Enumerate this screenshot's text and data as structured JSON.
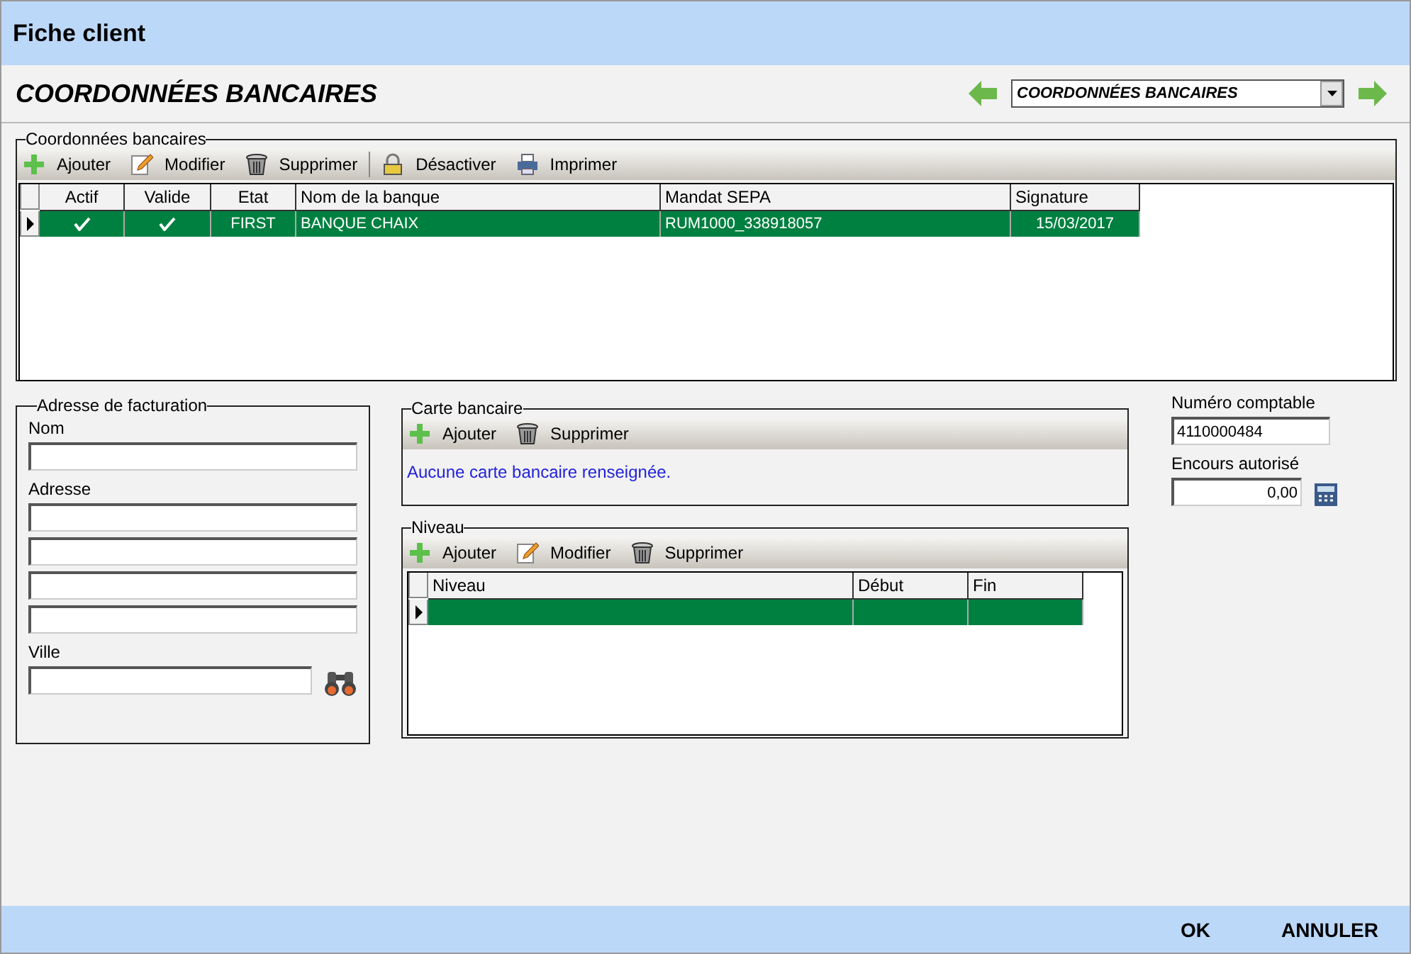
{
  "window": {
    "title": "Fiche client"
  },
  "header": {
    "title": "COORDONNÉES BANCAIRES",
    "select_value": "COORDONNÉES BANCAIRES"
  },
  "bank_details": {
    "title": "Coordonnées bancaires",
    "toolbar": [
      {
        "kind": "add",
        "label": "Ajouter"
      },
      {
        "kind": "edit",
        "label": "Modifier"
      },
      {
        "kind": "delete",
        "label": "Supprimer"
      },
      {
        "kind": "deactivate",
        "label": "Désactiver"
      },
      {
        "kind": "print",
        "label": "Imprimer"
      }
    ],
    "columns": [
      "Actif",
      "Valide",
      "Etat",
      "Nom de la banque",
      "Mandat SEPA",
      "Signature"
    ],
    "rows": [
      {
        "selected": true,
        "actif": true,
        "valide": true,
        "etat": "FIRST",
        "banque": "BANQUE CHAIX",
        "mandat": "RUM1000_338918057",
        "signature": "15/03/2017"
      }
    ]
  },
  "billing_address": {
    "title": "Adresse de facturation",
    "name_label": "Nom",
    "address_label": "Adresse",
    "city_label": "Ville"
  },
  "bank_card": {
    "title": "Carte bancaire",
    "toolbar": [
      {
        "kind": "add",
        "label": "Ajouter"
      },
      {
        "kind": "delete",
        "label": "Supprimer"
      }
    ],
    "empty_message": "Aucune carte bancaire renseignée."
  },
  "level": {
    "title": "Niveau",
    "toolbar": [
      {
        "kind": "add",
        "label": "Ajouter"
      },
      {
        "kind": "edit",
        "label": "Modifier"
      },
      {
        "kind": "delete",
        "label": "Supprimer"
      }
    ],
    "columns": [
      "Niveau",
      "Début",
      "Fin"
    ],
    "rows": [
      {
        "selected": true
      }
    ]
  },
  "accounting": {
    "account_label": "Numéro comptable",
    "account_value": "4110000484",
    "credit_label": "Encours autorisé",
    "credit_value": "0,00"
  },
  "buttons": [
    "OK",
    "ANNULER"
  ]
}
